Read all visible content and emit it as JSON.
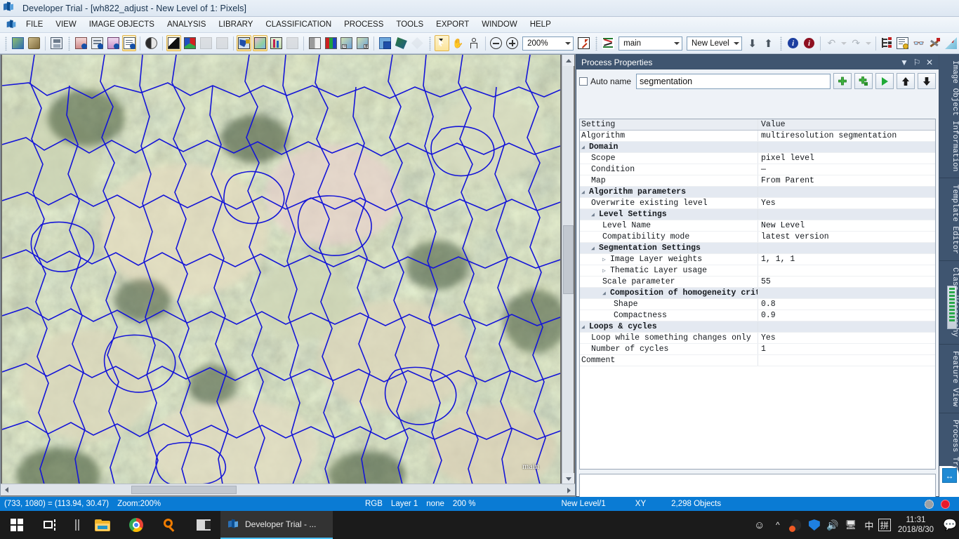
{
  "window": {
    "title": "Developer Trial - [wh822_adjust - New Level of 1: Pixels]",
    "app_icon": "app-logo-icon"
  },
  "menu": {
    "items": [
      {
        "label": "FILE"
      },
      {
        "label": "VIEW"
      },
      {
        "label": "IMAGE OBJECTS"
      },
      {
        "label": "ANALYSIS"
      },
      {
        "label": "LIBRARY"
      },
      {
        "label": "CLASSIFICATION"
      },
      {
        "label": "PROCESS"
      },
      {
        "label": "TOOLS"
      },
      {
        "label": "EXPORT"
      },
      {
        "label": "WINDOW"
      },
      {
        "label": "HELP"
      }
    ]
  },
  "toolbar": {
    "zoom_value": "200%",
    "map_value": "main",
    "level_value": "New Level",
    "buttons": [
      {
        "name": "open-project-icon"
      },
      {
        "name": "open-image-icon"
      },
      {
        "name": "save-project-icon"
      },
      {
        "name": "load-ruleset-1-icon"
      },
      {
        "name": "load-ruleset-2-icon"
      },
      {
        "name": "load-ruleset-3-icon"
      },
      {
        "name": "save-ruleset-icon"
      },
      {
        "name": "view-settings-icon"
      },
      {
        "name": "view-layer-gray-icon"
      },
      {
        "name": "view-layer-rgb-icon"
      },
      {
        "name": "view-classification-icon"
      },
      {
        "name": "view-samples-icon"
      },
      {
        "name": "pixel-view-icon"
      },
      {
        "name": "object-mean-view-icon"
      },
      {
        "name": "classification-view-icon"
      },
      {
        "name": "transparency-view-icon"
      },
      {
        "name": "show-outlines-white-icon"
      },
      {
        "name": "show-outlines-color-icon"
      },
      {
        "name": "layer-minus-icon"
      },
      {
        "name": "layer-plus-icon"
      },
      {
        "name": "copy-layer-icon"
      },
      {
        "name": "edit-layer-mixing-icon"
      },
      {
        "name": "compass-icon"
      },
      {
        "name": "select-arrow-icon"
      },
      {
        "name": "pan-hand-icon"
      },
      {
        "name": "select-object-icon"
      },
      {
        "name": "zoom-out-icon"
      },
      {
        "name": "zoom-in-icon"
      },
      {
        "name": "zoom-fit-icon"
      },
      {
        "name": "delete-level-icon"
      },
      {
        "name": "level-down-icon"
      },
      {
        "name": "level-up-icon"
      },
      {
        "name": "info-blue-icon"
      },
      {
        "name": "info-red-icon"
      },
      {
        "name": "undo-icon"
      },
      {
        "name": "redo-icon"
      },
      {
        "name": "process-tree-icon"
      },
      {
        "name": "edit-ruleset-icon"
      },
      {
        "name": "feature-view-icon"
      },
      {
        "name": "manage-tools-icon"
      },
      {
        "name": "measure-icon"
      }
    ]
  },
  "viewer": {
    "map_label": "main",
    "scroll_h": "horizontal-scrollbar",
    "scroll_v": "vertical-scrollbar"
  },
  "dock": {
    "title": "Process Properties",
    "collapse_glyph": "▼",
    "pin_glyph": "⚐",
    "close_glyph": "✕",
    "auto_name_label": "Auto name",
    "auto_name_checked": false,
    "process_name": "segmentation",
    "action_buttons": [
      {
        "name": "add-process-icon",
        "glyph": "✚"
      },
      {
        "name": "add-child-process-icon",
        "glyph": "✚"
      },
      {
        "name": "execute-process-icon",
        "glyph": "▶"
      },
      {
        "name": "move-up-icon",
        "glyph": "↑"
      },
      {
        "name": "move-down-icon",
        "glyph": "↓"
      }
    ],
    "grid": {
      "headers": [
        "Setting",
        "Value"
      ],
      "rows": [
        {
          "kind": "item",
          "indent": 0,
          "key": "Algorithm",
          "value": "multiresolution segmentation"
        },
        {
          "kind": "group",
          "indent": 0,
          "twisty": "open",
          "key": "Domain",
          "value": ""
        },
        {
          "kind": "item",
          "indent": 1,
          "key": "Scope",
          "value": "pixel level"
        },
        {
          "kind": "item",
          "indent": 1,
          "key": "Condition",
          "value": "—"
        },
        {
          "kind": "item",
          "indent": 1,
          "key": "Map",
          "value": "From Parent"
        },
        {
          "kind": "group",
          "indent": 0,
          "twisty": "open",
          "key": "Algorithm parameters",
          "value": ""
        },
        {
          "kind": "item",
          "indent": 1,
          "key": "Overwrite existing level",
          "value": "Yes"
        },
        {
          "kind": "group",
          "indent": 1,
          "twisty": "open",
          "key": "Level Settings",
          "value": ""
        },
        {
          "kind": "item",
          "indent": 2,
          "key": "Level Name",
          "value": "New Level"
        },
        {
          "kind": "item",
          "indent": 2,
          "key": "Compatibility mode",
          "value": "latest version"
        },
        {
          "kind": "group",
          "indent": 1,
          "twisty": "open",
          "key": "Segmentation Settings",
          "value": ""
        },
        {
          "kind": "item",
          "indent": 2,
          "twisty": "closed",
          "key": "Image Layer weights",
          "value": "1, 1, 1"
        },
        {
          "kind": "item",
          "indent": 2,
          "twisty": "closed",
          "key": "Thematic Layer usage",
          "value": ""
        },
        {
          "kind": "item",
          "indent": 2,
          "key": "Scale parameter",
          "value": "55"
        },
        {
          "kind": "group",
          "indent": 2,
          "twisty": "open",
          "key": "Composition of homogeneity criterion",
          "value": ""
        },
        {
          "kind": "item",
          "indent": 3,
          "key": "Shape",
          "value": "0.8"
        },
        {
          "kind": "item",
          "indent": 3,
          "key": "Compactness",
          "value": "0.9"
        },
        {
          "kind": "group",
          "indent": 0,
          "twisty": "open",
          "key": "Loops & cycles",
          "value": ""
        },
        {
          "kind": "item",
          "indent": 1,
          "key": "Loop while something changes only",
          "value": "Yes"
        },
        {
          "kind": "item",
          "indent": 1,
          "key": "Number of cycles",
          "value": "1"
        },
        {
          "kind": "item",
          "indent": 0,
          "key": "Comment",
          "value": ""
        }
      ]
    }
  },
  "side_tabs": [
    {
      "label": "Image Object Information"
    },
    {
      "label": "Template Editor"
    },
    {
      "label": "Class Hierarchy"
    },
    {
      "label": "Feature View"
    },
    {
      "label": "Process Tree"
    }
  ],
  "statusbar": {
    "coords": "(733, 1080) = (113.94, 30.47)",
    "zoom": "Zoom:200%",
    "mode": "RGB",
    "layer": "Layer 1",
    "none": "none",
    "percent": "200 %",
    "level": "New Level/1",
    "axes": "XY",
    "objects": "2,298 Objects"
  },
  "taskbar": {
    "start": "start-button",
    "items": [
      {
        "name": "task-view-icon"
      },
      {
        "name": "cortana-bars-icon"
      },
      {
        "name": "file-explorer-icon"
      },
      {
        "name": "chrome-icon"
      },
      {
        "name": "search-everything-icon"
      },
      {
        "name": "media-app-icon"
      }
    ],
    "active_task": "Developer Trial - ...",
    "tray": [
      {
        "name": "people-icon",
        "glyph": "⚉"
      },
      {
        "name": "show-hidden-icons-icon",
        "glyph": "∧"
      },
      {
        "name": "qq-icon",
        "glyph": "●"
      },
      {
        "name": "security-shield-icon",
        "glyph": "♥"
      },
      {
        "name": "volume-icon",
        "glyph": "ὐA"
      },
      {
        "name": "network-icon",
        "glyph": "⌸"
      },
      {
        "name": "ime-chinese-icon",
        "glyph": "中"
      },
      {
        "name": "ime-pinyin-icon",
        "glyph": "拼"
      }
    ],
    "time": "11:31",
    "date": "2018/8/30",
    "action_center": "notifications-icon"
  },
  "colors": {
    "accent": "#0a7bd4",
    "dock_header": "#3f5570",
    "segment_line": "#1111dd",
    "selected_tool": "#fbe49a"
  }
}
